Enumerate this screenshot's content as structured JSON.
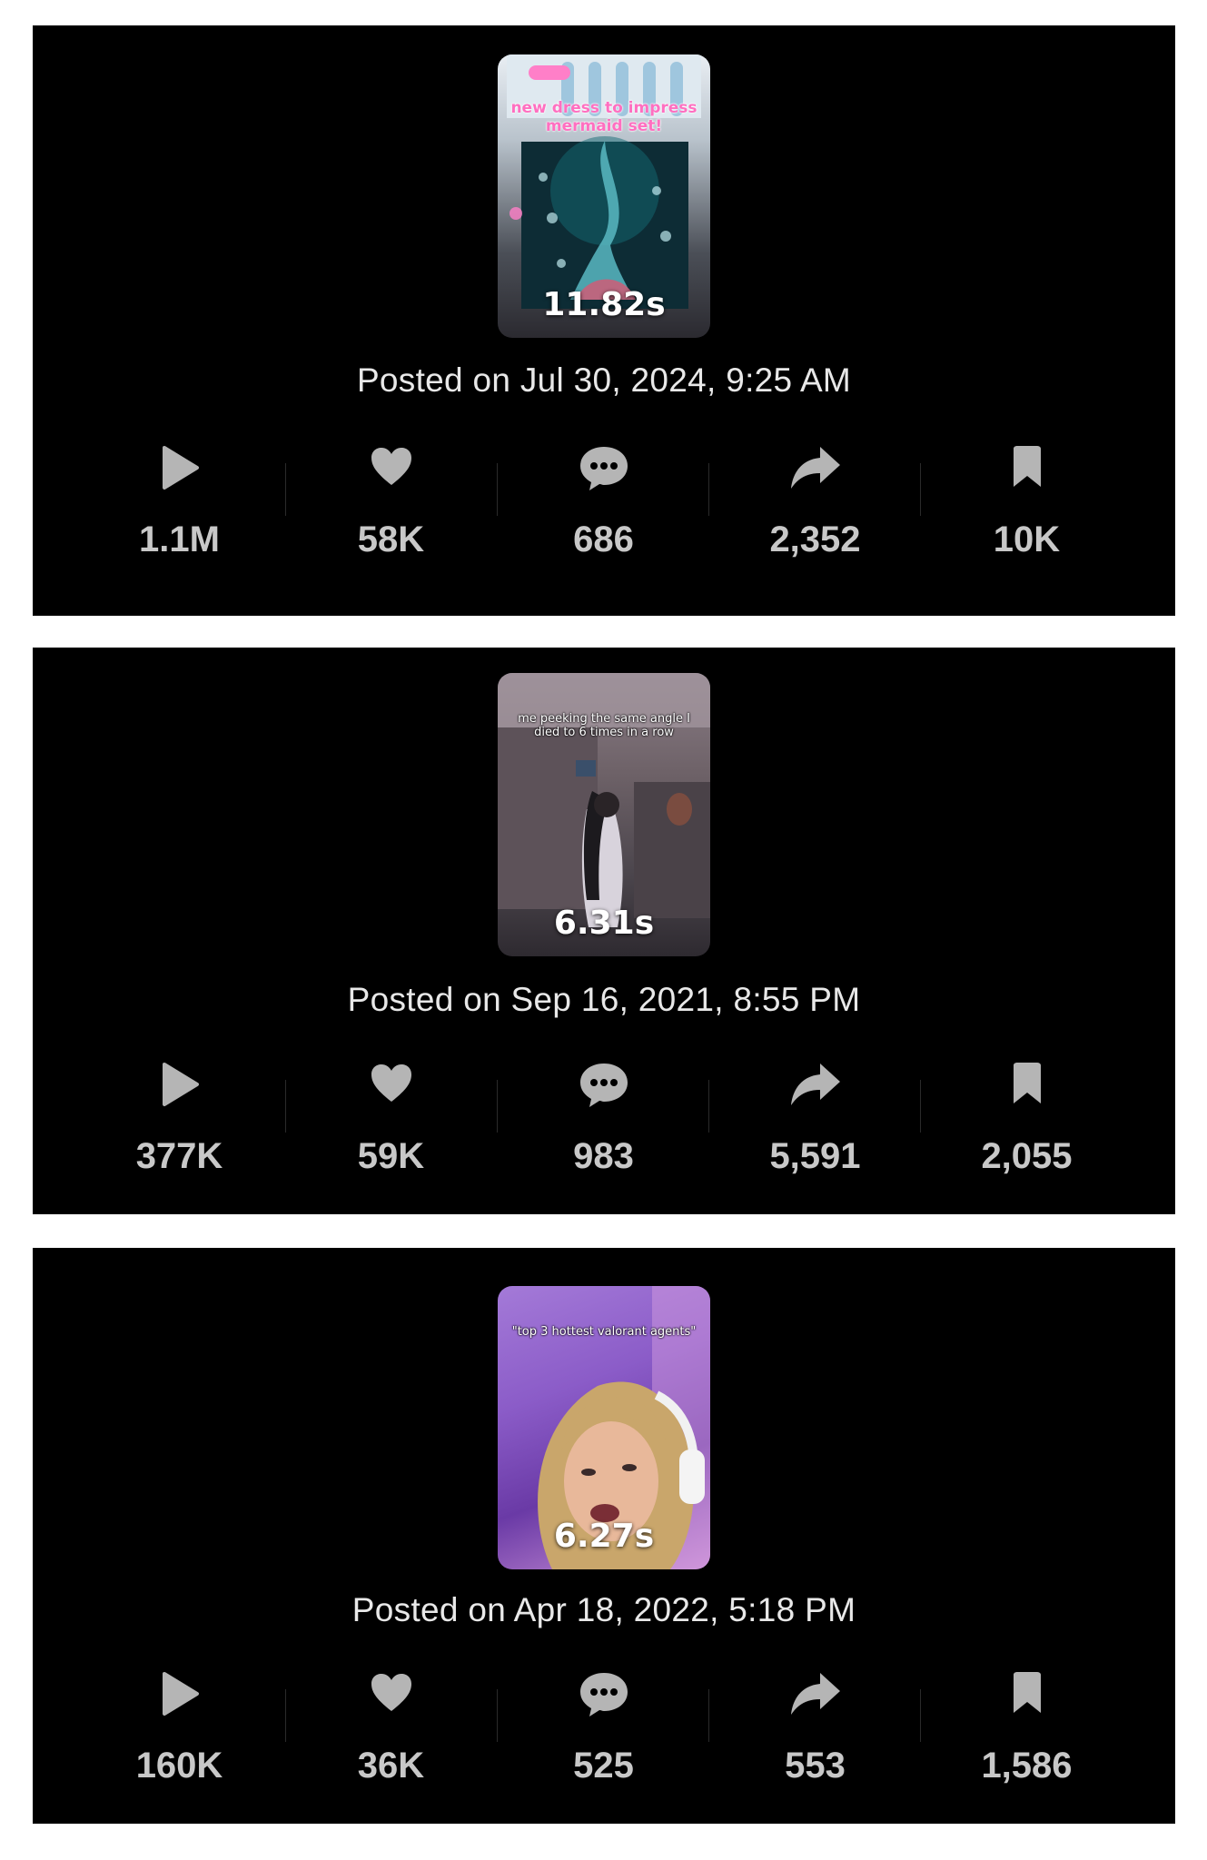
{
  "posts": [
    {
      "thumb_caption": "new dress to impress mermaid set!",
      "duration": "11.82s",
      "posted": "Posted on Jul 30, 2024, 9:25 AM",
      "stats": {
        "plays": "1.1M",
        "likes": "58K",
        "comments": "686",
        "shares": "2,352",
        "saves": "10K"
      }
    },
    {
      "thumb_caption": "me peeking the same angle I died to 6 times in a row",
      "duration": "6.31s",
      "posted": "Posted on Sep 16, 2021, 8:55 PM",
      "stats": {
        "plays": "377K",
        "likes": "59K",
        "comments": "983",
        "shares": "5,591",
        "saves": "2,055"
      }
    },
    {
      "thumb_caption": "\"top 3 hottest valorant agents\"",
      "duration": "6.27s",
      "posted": "Posted on Apr 18, 2022, 5:18 PM",
      "stats": {
        "plays": "160K",
        "likes": "36K",
        "comments": "525",
        "shares": "553",
        "saves": "1,586"
      }
    }
  ],
  "icons": {
    "plays": "play-icon",
    "likes": "heart-icon",
    "comments": "comment-icon",
    "shares": "share-icon",
    "saves": "bookmark-icon"
  },
  "colors": {
    "card_background": "#000000",
    "page_background": "#ffffff",
    "icon_gray": "#b5b5b5",
    "stat_text": "#c8c8c8",
    "posted_text": "#e8e8e8",
    "caption_pink": "#ff5fb0"
  }
}
